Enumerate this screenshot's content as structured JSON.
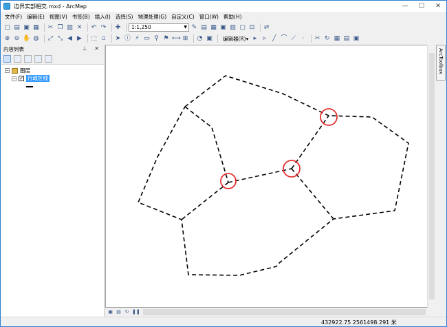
{
  "window": {
    "title": "边界实部相交.mxd - ArcMap",
    "controls": {
      "minimize": "—",
      "maximize": "☐",
      "close": "✕"
    }
  },
  "menu": [
    "文件(F)",
    "编辑(E)",
    "视图(V)",
    "书签(B)",
    "插入(I)",
    "选择(S)",
    "地理处理(G)",
    "自定义(C)",
    "窗口(W)",
    "帮助(H)"
  ],
  "toolbar": {
    "scale": "1:1,250",
    "editor_label": "编辑器(R)▾"
  },
  "toc": {
    "title": "内容列表",
    "header_controls": "⊥ ✕",
    "layers_group": "图层",
    "layer_name": "行政区线",
    "layer_checked": "✓"
  },
  "toolbox_tab": "ArcToolbox",
  "status": {
    "coordinates": "432922.75   2561498.291 米"
  },
  "map_features": {
    "line_style": "dashed-black",
    "highlight_color": "#e53030",
    "highlight_count": 3
  },
  "icons": [
    "new-doc-icon",
    "open-icon",
    "save-icon",
    "print-icon",
    "cut-icon",
    "copy-icon",
    "paste-icon",
    "delete-icon",
    "undo-icon",
    "redo-icon",
    "add-data-icon",
    "zoom-in-icon",
    "zoom-out-icon",
    "pan-icon",
    "full-extent-icon",
    "select-icon",
    "identify-icon",
    "find-icon",
    "measure-icon"
  ]
}
